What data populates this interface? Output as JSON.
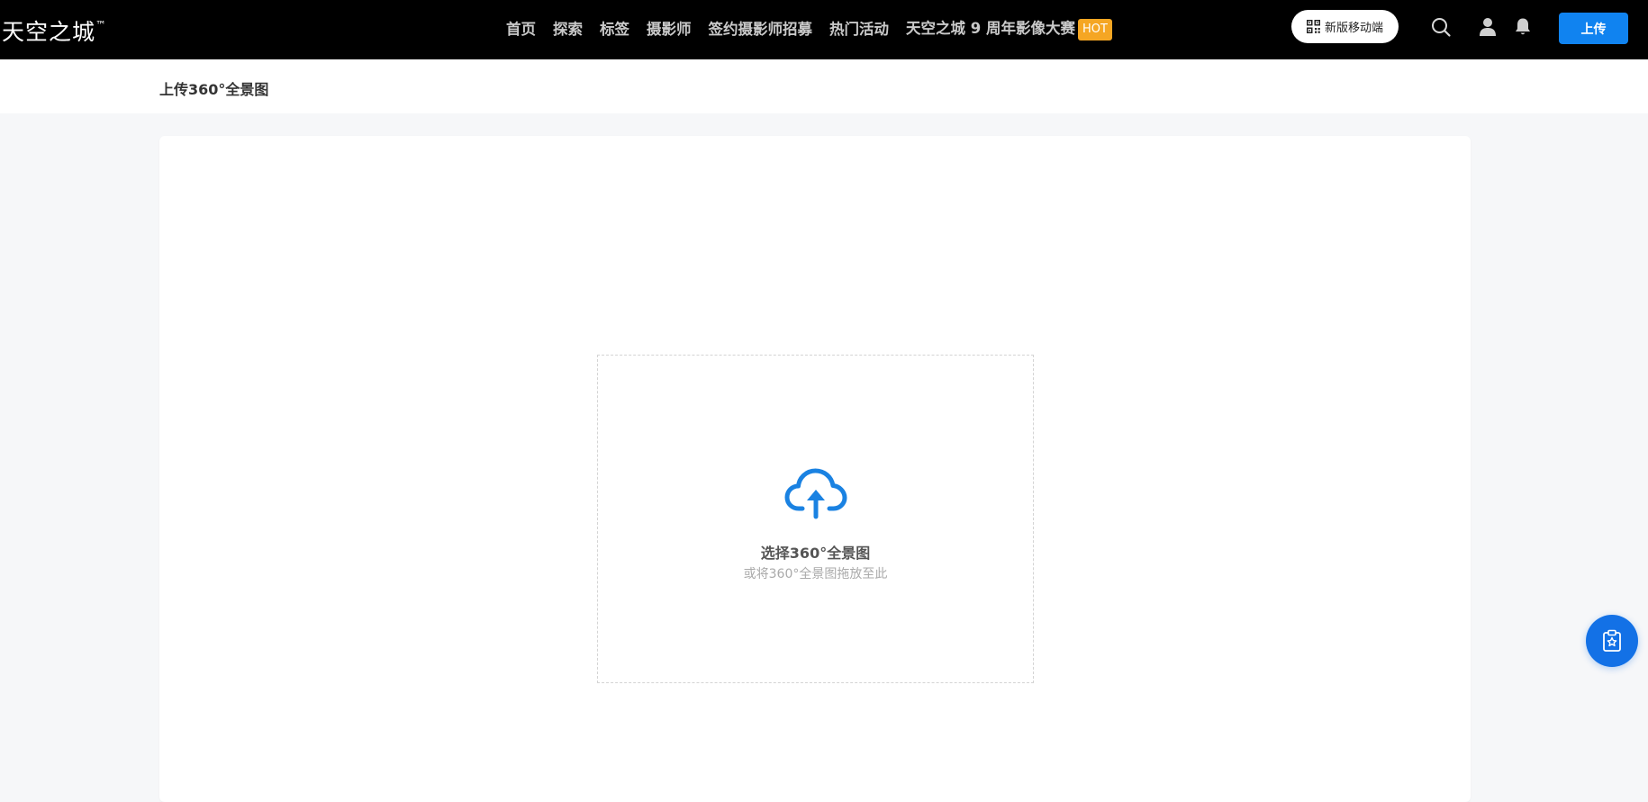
{
  "header": {
    "logo_text": "天空之城",
    "logo_mark": "™",
    "nav": [
      {
        "label": "首页"
      },
      {
        "label": "探索"
      },
      {
        "label": "标签"
      },
      {
        "label": "摄影师"
      },
      {
        "label": "签约摄影师招募"
      },
      {
        "label": "热门活动"
      },
      {
        "label": "天空之城 9 周年影像大赛",
        "badge": "HOT"
      }
    ],
    "mobile_label": "新版移动端",
    "upload_label": "上传",
    "icons": [
      "qrcode-icon",
      "search-icon",
      "user-icon",
      "bell-icon"
    ]
  },
  "page": {
    "title": "上传360°全景图"
  },
  "dropzone": {
    "icon": "cloud-upload-icon",
    "title": "选择360°全景图",
    "hint": "或将360°全景图拖放至此"
  },
  "float_button": {
    "icon": "clipboard-star-icon"
  },
  "colors": {
    "topbar_bg": "#000000",
    "accent": "#1083f0",
    "hot_badge": "#f5a623",
    "page_bg": "#f6f7f9"
  }
}
